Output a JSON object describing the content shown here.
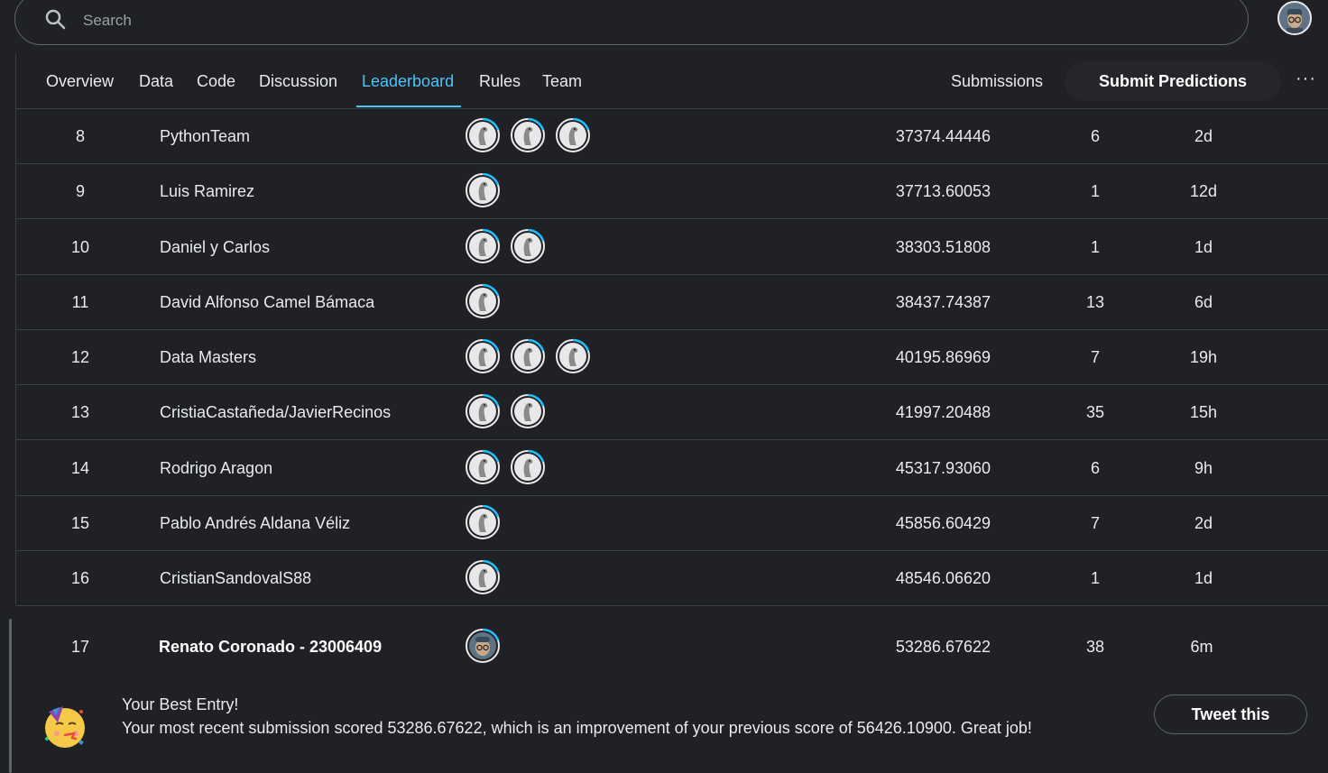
{
  "search": {
    "placeholder": "Search"
  },
  "tabs": [
    {
      "label": "Overview"
    },
    {
      "label": "Data"
    },
    {
      "label": "Code"
    },
    {
      "label": "Discussion"
    },
    {
      "label": "Leaderboard",
      "active": true
    },
    {
      "label": "Rules"
    },
    {
      "label": "Team"
    }
  ],
  "actions": {
    "submissions": "Submissions",
    "submit_predictions": "Submit Predictions",
    "more": "···"
  },
  "leaderboard": {
    "rows": [
      {
        "rank": "8",
        "team": "PythonTeam",
        "members": 3,
        "score": "37374.44446",
        "entries": "6",
        "last": "2d"
      },
      {
        "rank": "9",
        "team": "Luis Ramirez",
        "members": 1,
        "score": "37713.60053",
        "entries": "1",
        "last": "12d"
      },
      {
        "rank": "10",
        "team": "Daniel y Carlos",
        "members": 2,
        "score": "38303.51808",
        "entries": "1",
        "last": "1d"
      },
      {
        "rank": "11",
        "team": "David Alfonso Camel Bámaca",
        "members": 1,
        "score": "38437.74387",
        "entries": "13",
        "last": "6d"
      },
      {
        "rank": "12",
        "team": "Data Masters",
        "members": 3,
        "score": "40195.86969",
        "entries": "7",
        "last": "19h"
      },
      {
        "rank": "13",
        "team": "CristiaCastañeda/JavierRecinos",
        "members": 2,
        "score": "41997.20488",
        "entries": "35",
        "last": "15h"
      },
      {
        "rank": "14",
        "team": "Rodrigo Aragon",
        "members": 2,
        "score": "45317.93060",
        "entries": "6",
        "last": "9h"
      },
      {
        "rank": "15",
        "team": "Pablo Andrés Aldana Véliz",
        "members": 1,
        "score": "45856.60429",
        "entries": "7",
        "last": "2d"
      },
      {
        "rank": "16",
        "team": "CristianSandovalS88",
        "members": 1,
        "score": "48546.06620",
        "entries": "1",
        "last": "1d"
      }
    ],
    "my_row": {
      "rank": "17",
      "team": "Renato Coronado - 23006409",
      "score": "53286.67622",
      "entries": "38",
      "last": "6m"
    }
  },
  "banner": {
    "title": "Your Best Entry!",
    "message": "Your most recent submission scored 53286.67622, which is an improvement of your previous score of 56426.10900. Great job!",
    "tweet_label": "Tweet this",
    "icon": "party-face-emoji"
  },
  "colors": {
    "background": "#202124",
    "accent": "#4fc3f7",
    "avatar_ring": "#20BEFF"
  }
}
